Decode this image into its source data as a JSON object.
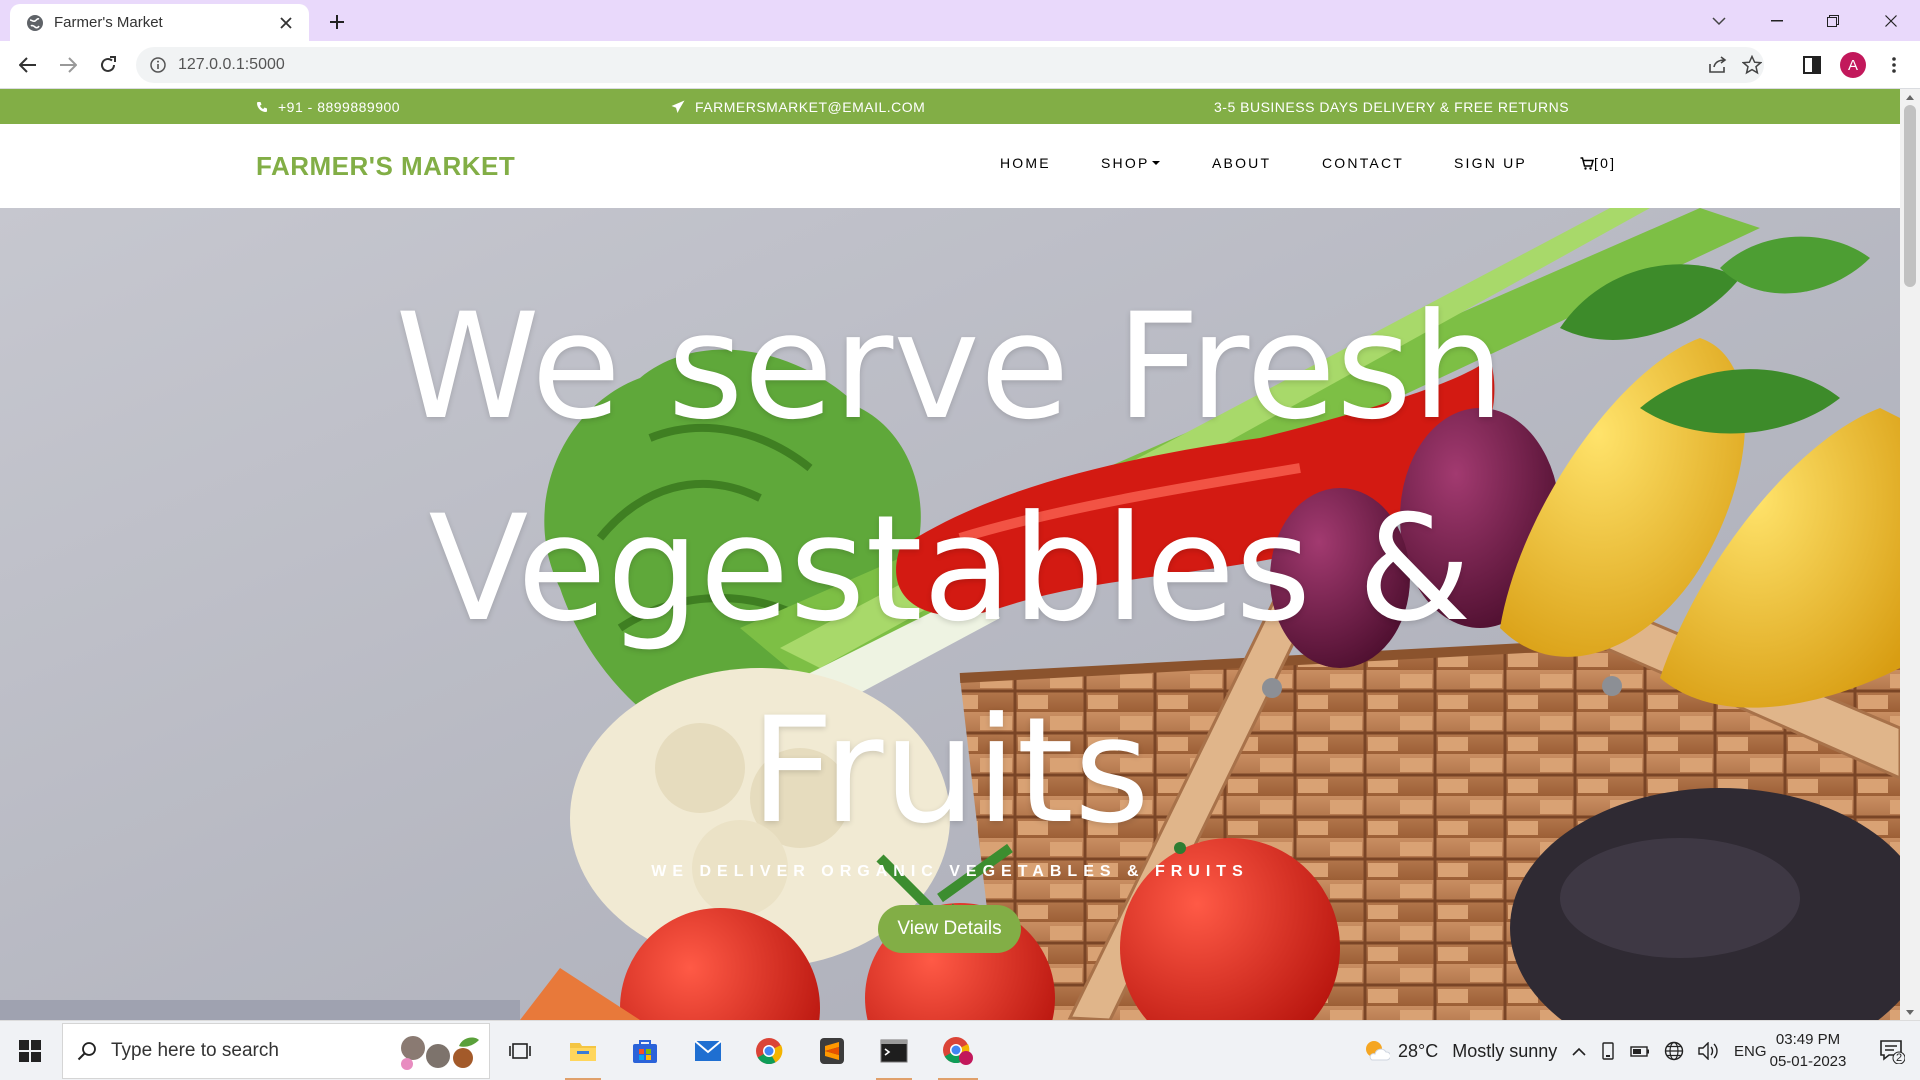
{
  "browser": {
    "tab_title": "Farmer's Market",
    "url": "127.0.0.1:5000",
    "profile_initial": "A"
  },
  "site": {
    "topbar": {
      "phone": "+91 - 8899889900",
      "email": "FARMERSMARKET@EMAIL.COM",
      "delivery": "3-5 BUSINESS DAYS DELIVERY & FREE RETURNS"
    },
    "brand": "FARMER'S MARKET",
    "nav": {
      "home": "HOME",
      "shop": "SHOP",
      "about": "ABOUT",
      "contact": "CONTACT",
      "signup": "SIGN UP",
      "cart": "[0]"
    },
    "hero": {
      "title": "We serve Fresh Vegestables & Fruits",
      "subtitle": "WE DELIVER ORGANIC VEGETABLES & FRUITS",
      "button": "View Details"
    }
  },
  "taskbar": {
    "search_placeholder": "Type here to search",
    "weather_temp": "28°C",
    "weather_text": "Mostly sunny",
    "language": "ENG",
    "time": "03:49 PM",
    "date": "05-01-2023",
    "notification_count": "2"
  },
  "colors": {
    "accent_green": "#82ae46",
    "tab_strip": "#e9d9fb"
  },
  "icons": [
    "globe-icon",
    "close-icon",
    "plus-icon",
    "back-icon",
    "forward-icon",
    "reload-icon",
    "info-icon",
    "share-icon",
    "star-icon",
    "sidepanel-icon",
    "kebab-icon",
    "phone-icon",
    "paper-plane-icon",
    "cart-icon",
    "windows-icon",
    "search-icon",
    "task-view-icon",
    "file-explorer-icon",
    "store-icon",
    "mail-icon",
    "chrome-icon",
    "sublime-icon",
    "terminal-icon",
    "weather-icon",
    "notification-icon"
  ]
}
